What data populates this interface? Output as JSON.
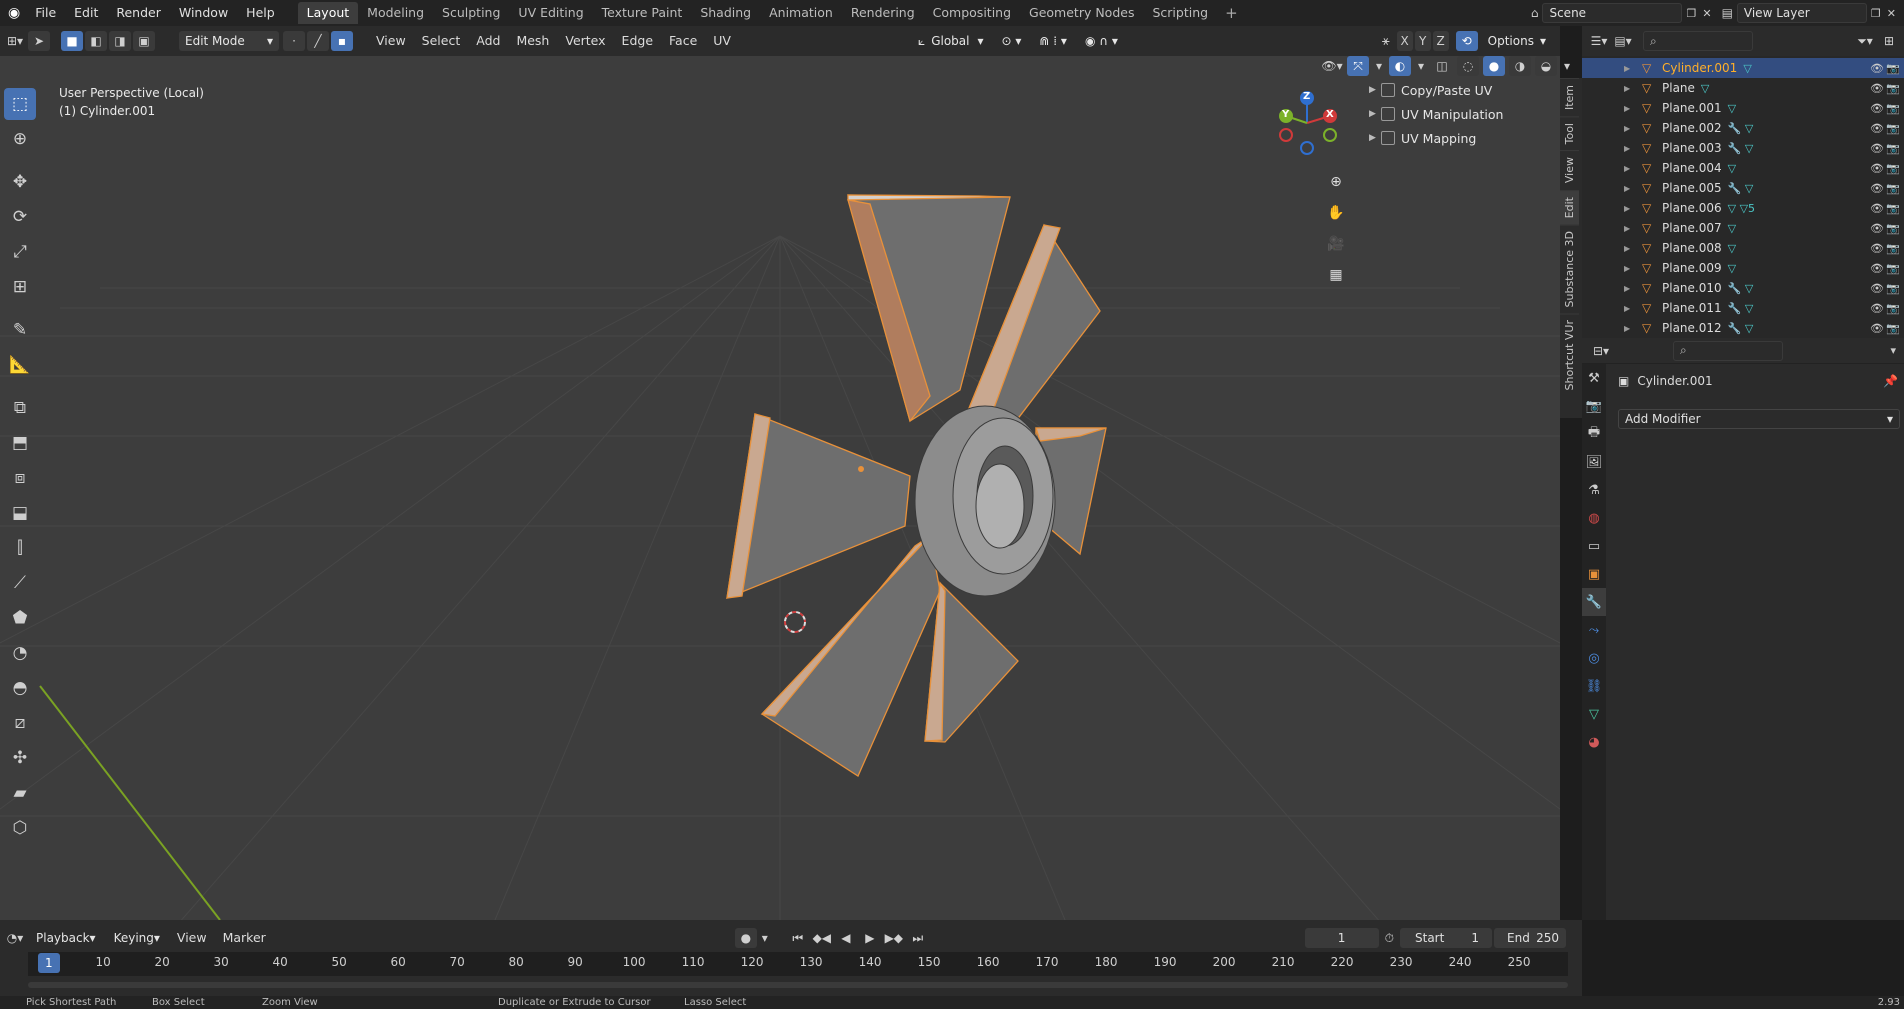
{
  "topbar": {
    "menus": [
      "File",
      "Edit",
      "Render",
      "Window",
      "Help"
    ],
    "workspaces": [
      "Layout",
      "Modeling",
      "Sculpting",
      "UV Editing",
      "Texture Paint",
      "Shading",
      "Animation",
      "Rendering",
      "Compositing",
      "Geometry Nodes",
      "Scripting"
    ],
    "active_workspace": "Layout",
    "scene": "Scene",
    "view_layer": "View Layer"
  },
  "viewport_header": {
    "mode": "Edit Mode",
    "menus": [
      "View",
      "Select",
      "Add",
      "Mesh",
      "Vertex",
      "Edge",
      "Face",
      "UV"
    ],
    "transform_orientation": "Global",
    "axes": [
      "X",
      "Y",
      "Z"
    ],
    "options": "Options"
  },
  "viewport": {
    "perspective": "User Perspective (Local)",
    "object": "(1) Cylinder.001",
    "gizmo": {
      "x": "X",
      "y": "Y",
      "z": "Z"
    }
  },
  "npanel": {
    "items": [
      "Copy/Paste UV",
      "UV Manipulation",
      "UV Mapping"
    ],
    "tabs": [
      "Item",
      "Tool",
      "View",
      "Edit",
      "Substance 3D",
      "Shortcut VUr"
    ]
  },
  "outliner": {
    "rows": [
      {
        "name": "Cylinder.001",
        "mods": "▽",
        "selected": true
      },
      {
        "name": "Plane",
        "mods": "▽",
        "selected": false
      },
      {
        "name": "Plane.001",
        "mods": "▽",
        "selected": false
      },
      {
        "name": "Plane.002",
        "mods": "🔧 ▽",
        "selected": false
      },
      {
        "name": "Plane.003",
        "mods": "🔧 ▽",
        "selected": false
      },
      {
        "name": "Plane.004",
        "mods": "▽",
        "selected": false
      },
      {
        "name": "Plane.005",
        "mods": "🔧 ▽",
        "selected": false
      },
      {
        "name": "Plane.006",
        "mods": "▽ ▽5",
        "selected": false
      },
      {
        "name": "Plane.007",
        "mods": "▽",
        "selected": false
      },
      {
        "name": "Plane.008",
        "mods": "▽",
        "selected": false
      },
      {
        "name": "Plane.009",
        "mods": "▽",
        "selected": false
      },
      {
        "name": "Plane.010",
        "mods": "🔧 ▽",
        "selected": false
      },
      {
        "name": "Plane.011",
        "mods": "🔧 ▽",
        "selected": false
      },
      {
        "name": "Plane.012",
        "mods": "🔧 ▽",
        "selected": false
      }
    ]
  },
  "properties": {
    "object_name": "Cylinder.001",
    "add_modifier": "Add Modifier"
  },
  "timeline": {
    "menus": [
      "Playback",
      "Keying",
      "View",
      "Marker"
    ],
    "current_frame": "1",
    "start_label": "Start",
    "start": "1",
    "end_label": "End",
    "end": "250",
    "ticks": [
      "1",
      "10",
      "20",
      "30",
      "40",
      "50",
      "60",
      "70",
      "80",
      "90",
      "100",
      "110",
      "120",
      "130",
      "140",
      "150",
      "160",
      "170",
      "180",
      "190",
      "200",
      "210",
      "220",
      "230",
      "240",
      "250"
    ]
  },
  "statusbar": {
    "items": [
      "Pick Shortest Path",
      "Box Select",
      "Zoom View",
      "Duplicate or Extrude to Cursor",
      "Lasso Select"
    ],
    "version": "2.93"
  },
  "colors": {
    "accent": "#4772b3",
    "selected_orange": "#ffaf29",
    "edge_orange": "#e8913a",
    "viewport_bg": "#3d3d3d"
  }
}
